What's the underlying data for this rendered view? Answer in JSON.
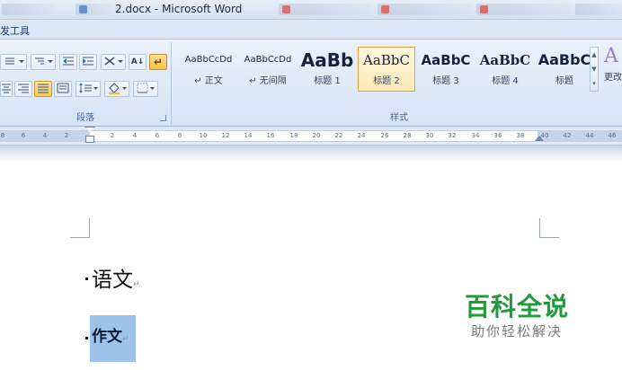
{
  "window": {
    "title": "2.docx - Microsoft Word"
  },
  "ribbon": {
    "context_tab_label": "发工具",
    "paragraph_group": {
      "label": "段落",
      "sort_glyph": "A↓",
      "para_mark_glyph": "↵"
    },
    "styles_group": {
      "label": "样式",
      "change_styles_label": "更改",
      "styles": [
        {
          "sample": "AaBbCcDd",
          "caption": "↵ 正文"
        },
        {
          "sample": "AaBbCcDd",
          "caption": "↵ 无间隔"
        },
        {
          "sample": "AaBb",
          "caption": "标题 1"
        },
        {
          "sample": "AaBbC",
          "caption": "标题 2"
        },
        {
          "sample": "AaBbC",
          "caption": "标题 3"
        },
        {
          "sample": "AaBbC",
          "caption": "标题 4"
        },
        {
          "sample": "AaBbC",
          "caption": "标题"
        }
      ],
      "selected_style": "标题 2"
    }
  },
  "ruler": {
    "ticks": [
      "8",
      "6",
      "4",
      "2",
      "2",
      "4",
      "6",
      "8",
      "10",
      "12",
      "14",
      "16",
      "18",
      "20",
      "22",
      "24",
      "26",
      "28",
      "30",
      "32",
      "34",
      "36",
      "38",
      "40",
      "42",
      "44",
      "46"
    ]
  },
  "document": {
    "paragraphs": [
      {
        "text": "语文",
        "mark": "↵"
      },
      {
        "text": "作文",
        "mark": "↵",
        "selected": true
      }
    ]
  },
  "watermark": {
    "title": "百科全说",
    "subtitle": "助你轻松解决"
  },
  "colors": {
    "selection": "#9dc3ea",
    "selected_style_border": "#e2a443",
    "watermark_green": "#1f9b3c"
  }
}
